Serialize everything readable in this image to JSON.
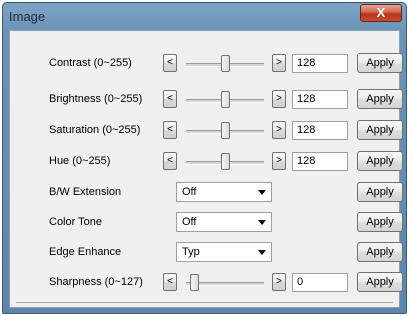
{
  "window": {
    "title": "Image",
    "close_label": "X"
  },
  "controls": [
    {
      "kind": "slider",
      "label": "Contrast (0~255)",
      "value": "128",
      "level": 0.5
    },
    {
      "kind": "slider",
      "label": "Brightness (0~255)",
      "value": "128",
      "level": 0.5
    },
    {
      "kind": "slider",
      "label": "Saturation (0~255)",
      "value": "128",
      "level": 0.5
    },
    {
      "kind": "slider",
      "label": "Hue (0~255)",
      "value": "128",
      "level": 0.5
    },
    {
      "kind": "select",
      "label": "B/W Extension",
      "value": "Off"
    },
    {
      "kind": "select",
      "label": "Color Tone",
      "value": "Off"
    },
    {
      "kind": "select",
      "label": "Edge Enhance",
      "value": "Typ"
    },
    {
      "kind": "slider",
      "label": "Sharpness (0~127)",
      "value": "0",
      "level": 0.0
    }
  ],
  "buttons": {
    "apply": "Apply",
    "decrement": "<",
    "increment": ">"
  }
}
